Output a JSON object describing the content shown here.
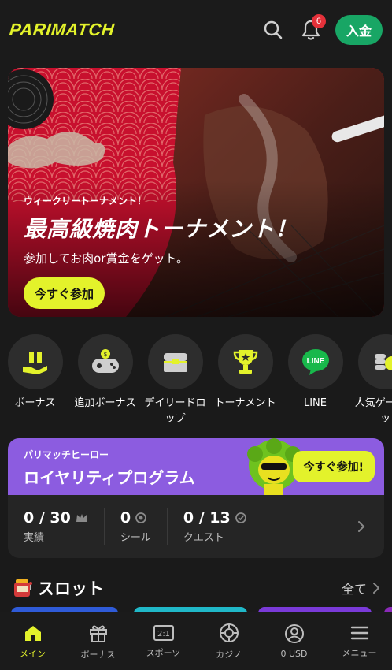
{
  "header": {
    "logo_text": "PARIMATCH",
    "notification_count": "6",
    "deposit_label": "入金"
  },
  "banner": {
    "kicker": "ウィークリートーナメント！",
    "title": "最高級焼肉トーナメント！",
    "subtitle": "参加してお肉or賞金をゲット。",
    "cta": "今すぐ参加"
  },
  "quicknav": {
    "items": [
      {
        "label": "ボーナス",
        "icon": "gift-hand-icon"
      },
      {
        "label": "追加ボーナス",
        "icon": "gamepad-icon"
      },
      {
        "label": "デイリードロップ",
        "icon": "treasure-chest-icon"
      },
      {
        "label": "トーナメント",
        "icon": "trophy-icon"
      },
      {
        "label": "LINE",
        "icon": "line-icon"
      },
      {
        "label": "人気ゲームベッ",
        "icon": "coins-icon"
      }
    ]
  },
  "loyalty": {
    "kicker": "パリマッチヒーロー",
    "title": "ロイヤリティプログラム",
    "cta": "今すぐ参加!",
    "stats": [
      {
        "value": "0 / 30",
        "label": "実績",
        "icon": "crown-icon"
      },
      {
        "value": "0",
        "label": "シール",
        "icon": "seal-icon"
      },
      {
        "value": "0 / 13",
        "label": "クエスト",
        "icon": "quest-icon"
      }
    ]
  },
  "slots": {
    "title": "スロット",
    "see_all": "全て"
  },
  "bottom_nav": {
    "items": [
      {
        "label": "メイン",
        "icon": "home-icon",
        "active": true
      },
      {
        "label": "ボーナス",
        "icon": "gift-icon",
        "active": false
      },
      {
        "label": "スポーツ",
        "icon": "sports-icon",
        "active": false
      },
      {
        "label": "カジノ",
        "icon": "casino-chip-icon",
        "active": false
      },
      {
        "label": "0 USD",
        "icon": "account-icon",
        "active": false
      },
      {
        "label": "メニュー",
        "icon": "menu-icon",
        "active": false
      }
    ]
  },
  "colors": {
    "accent": "#e3f22b",
    "deposit": "#18a665",
    "loyalty": "#8c5ce0",
    "badge": "#e5313a",
    "background": "#1a1a1a"
  }
}
